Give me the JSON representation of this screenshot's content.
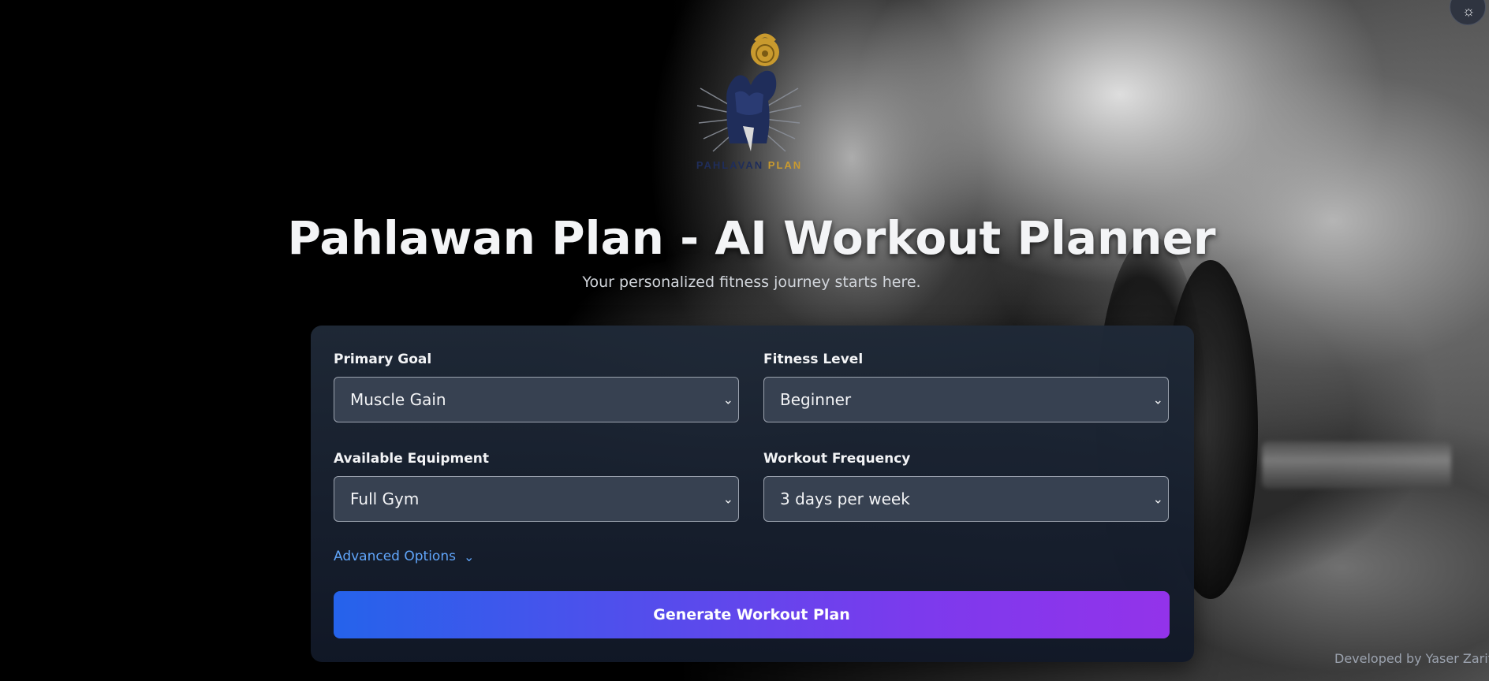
{
  "header": {
    "logo": {
      "brand_primary": "PAHLAVAN",
      "brand_secondary": "PLAN",
      "icon": "kettlebell-strongman-logo"
    },
    "title": "Pahlawan Plan - AI Workout Planner",
    "subtitle": "Your personalized fitness journey starts here.",
    "theme_toggle_icon": "sun-icon"
  },
  "form": {
    "primary_goal": {
      "label": "Primary Goal",
      "value": "Muscle Gain"
    },
    "fitness_level": {
      "label": "Fitness Level",
      "value": "Beginner"
    },
    "equipment": {
      "label": "Available Equipment",
      "value": "Full Gym"
    },
    "frequency": {
      "label": "Workout Frequency",
      "value": "3 days per week"
    },
    "advanced_label": "Advanced Options",
    "submit_label": "Generate Workout Plan"
  },
  "footer": {
    "credit": "Developed by Yaser Zarifi"
  },
  "colors": {
    "accent_link": "#60a5fa",
    "button_gradient_start": "#2563eb",
    "button_gradient_end": "#9333ea",
    "card_bg": "#1f2937",
    "select_bg": "#374151",
    "logo_navy": "#1f2d5a",
    "logo_gold": "#c99a2e"
  }
}
